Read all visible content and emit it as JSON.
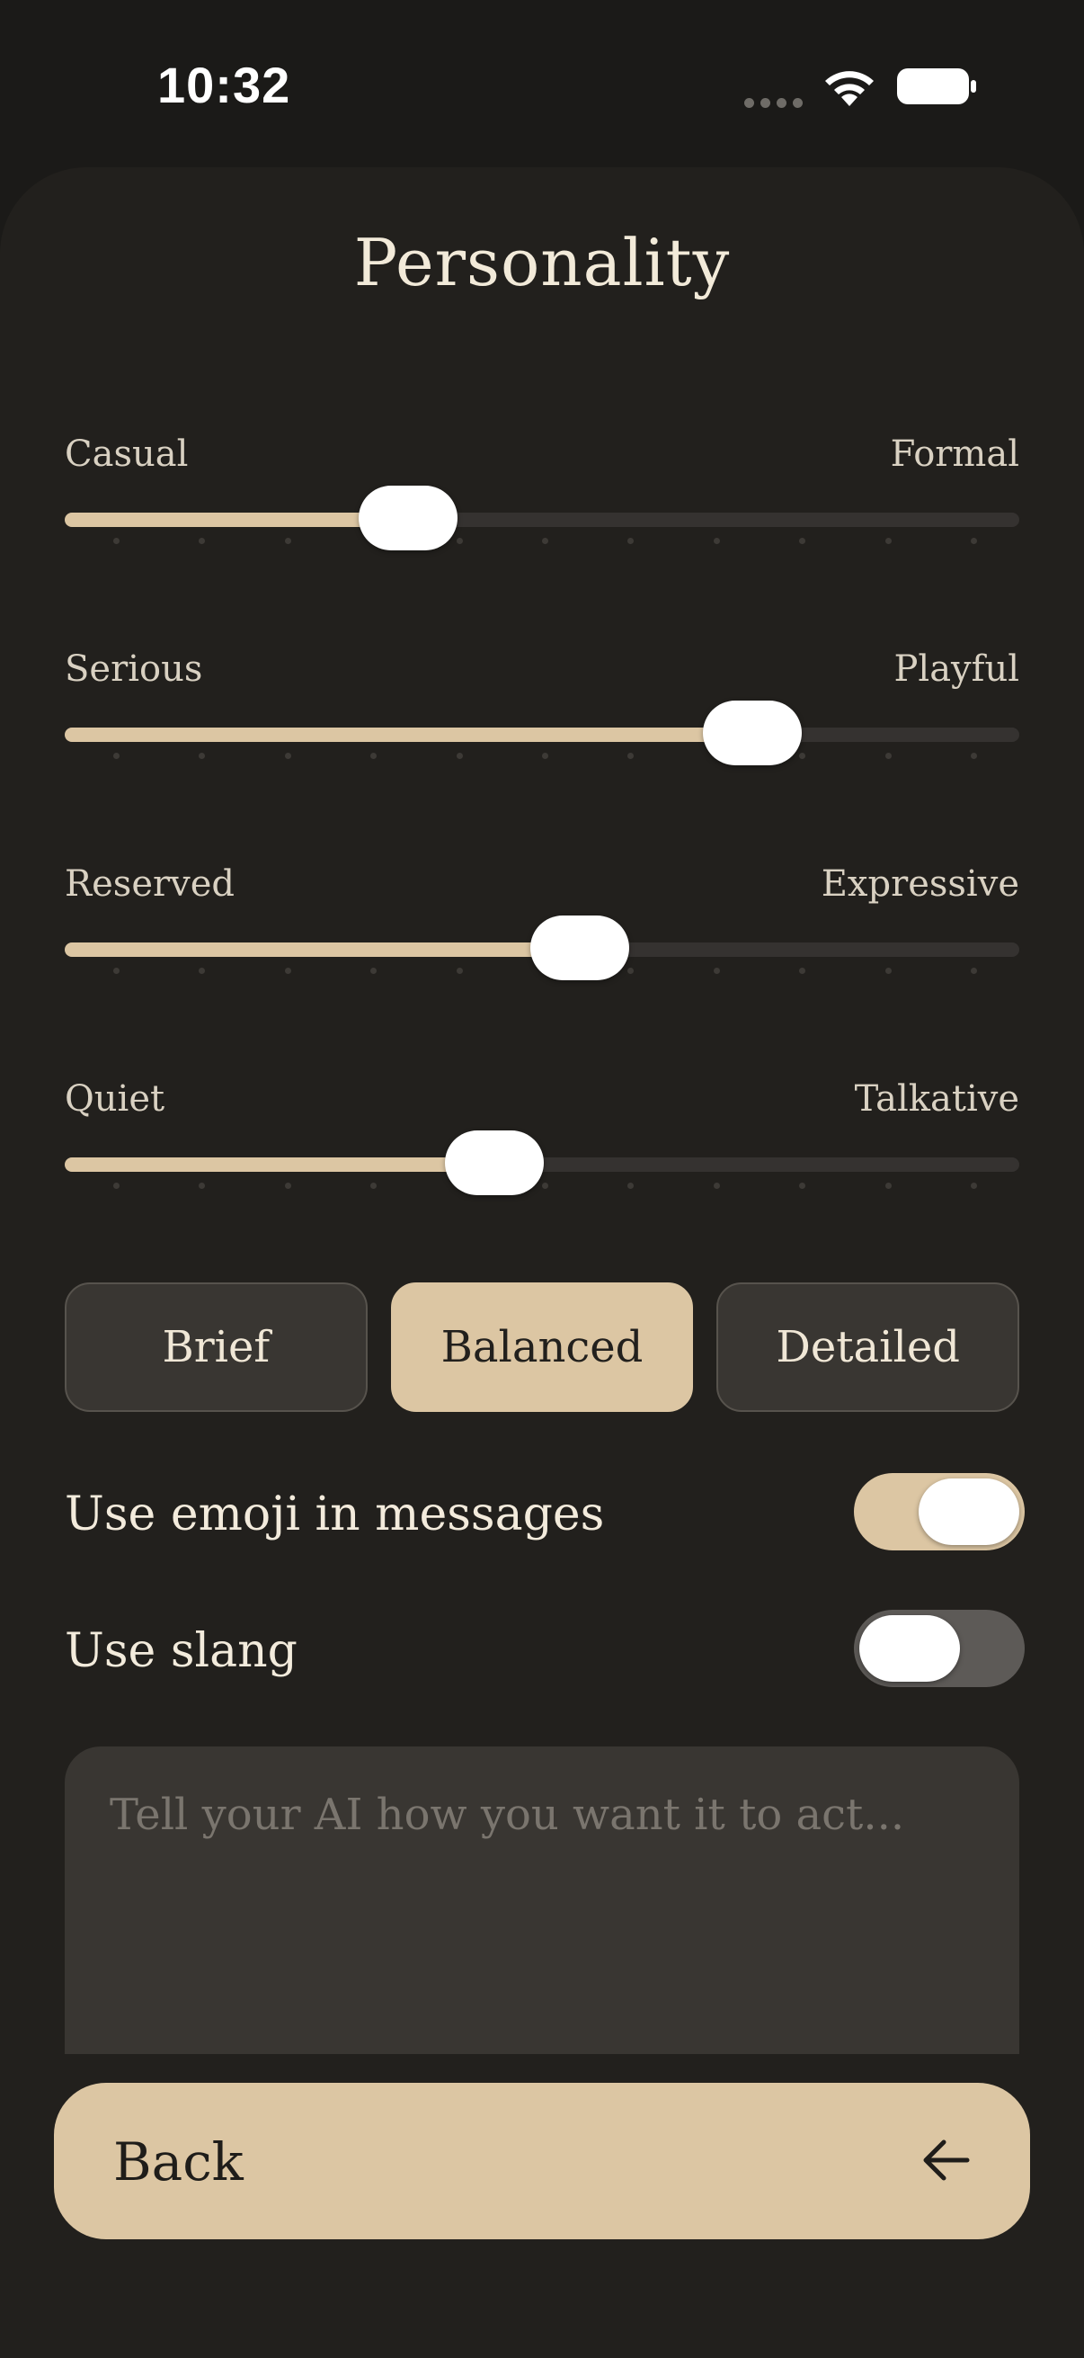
{
  "status_bar": {
    "time": "10:32",
    "signal_icon": "cellular-signal-dots-icon",
    "wifi_icon": "wifi-icon",
    "battery_icon": "battery-full-icon"
  },
  "page": {
    "title": "Personality"
  },
  "sliders": [
    {
      "left_label": "Casual",
      "right_label": "Formal",
      "value": 0.36
    },
    {
      "left_label": "Serious",
      "right_label": "Playful",
      "value": 0.72
    },
    {
      "left_label": "Reserved",
      "right_label": "Expressive",
      "value": 0.54
    },
    {
      "left_label": "Quiet",
      "right_label": "Talkative",
      "value": 0.45
    }
  ],
  "slider_tick_count": 11,
  "length_options": [
    {
      "label": "Brief",
      "selected": false
    },
    {
      "label": "Balanced",
      "selected": true
    },
    {
      "label": "Detailed",
      "selected": false
    }
  ],
  "toggles": [
    {
      "label": "Use emoji in messages",
      "on": true
    },
    {
      "label": "Use slang",
      "on": false
    }
  ],
  "instructions": {
    "value": "",
    "placeholder": "Tell your AI how you want it to act..."
  },
  "back_button": {
    "label": "Back",
    "icon": "arrow-left-icon"
  },
  "colors": {
    "background": "#22201d",
    "accent": "#dcc6a3",
    "track": "#353230",
    "surface": "#393632",
    "text": "#f2ead9"
  }
}
